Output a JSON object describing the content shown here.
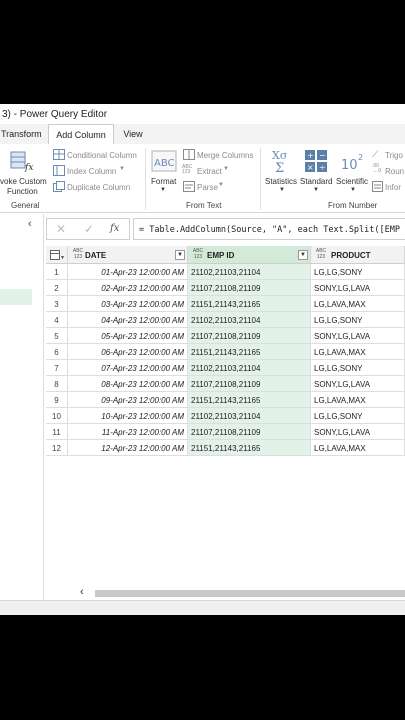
{
  "window": {
    "title": "3) - Power Query Editor"
  },
  "tabs": [
    {
      "label": "Transform",
      "active": false
    },
    {
      "label": "Add Column",
      "active": true
    },
    {
      "label": "View",
      "active": false
    }
  ],
  "ribbon": {
    "general": {
      "invoke_line1": "voke Custom",
      "invoke_line2": "Function",
      "conditional": "Conditional Column",
      "index": "Index Column",
      "duplicate": "Duplicate Column",
      "label": "General"
    },
    "from_text": {
      "format": "Format",
      "merge": "Merge Columns",
      "extract": "Extract",
      "parse": "Parse",
      "label": "From Text"
    },
    "from_number": {
      "statistics": "Statistics",
      "standard": "Standard",
      "scientific": "Scientific",
      "trig": "Trigo",
      "round": "Roun",
      "info": "Infor",
      "label": "From Number"
    }
  },
  "formula_bar": {
    "fx": "fx",
    "formula": "= Table.AddColumn(Source, \"A\", each Text.Split([EMP"
  },
  "table": {
    "type_labels": {
      "abc": "ABC",
      "num": "123"
    },
    "columns": [
      "DATE",
      "EMP ID",
      "PRODUCT"
    ],
    "rows": [
      {
        "n": "1",
        "date": "01-Apr-23 12:00:00 AM",
        "emp": "21102,21103,21104",
        "prod": "LG,LG,SONY"
      },
      {
        "n": "2",
        "date": "02-Apr-23 12:00:00 AM",
        "emp": "21107,21108,21109",
        "prod": "SONY,LG,LAVA"
      },
      {
        "n": "3",
        "date": "03-Apr-23 12:00:00 AM",
        "emp": "21151,21143,21165",
        "prod": "LG,LAVA,MAX"
      },
      {
        "n": "4",
        "date": "04-Apr-23 12:00:00 AM",
        "emp": "21102,21103,21104",
        "prod": "LG,LG,SONY"
      },
      {
        "n": "5",
        "date": "05-Apr-23 12:00:00 AM",
        "emp": "21107,21108,21109",
        "prod": "SONY,LG,LAVA"
      },
      {
        "n": "6",
        "date": "06-Apr-23 12:00:00 AM",
        "emp": "21151,21143,21165",
        "prod": "LG,LAVA,MAX"
      },
      {
        "n": "7",
        "date": "07-Apr-23 12:00:00 AM",
        "emp": "21102,21103,21104",
        "prod": "LG,LG,SONY"
      },
      {
        "n": "8",
        "date": "08-Apr-23 12:00:00 AM",
        "emp": "21107,21108,21109",
        "prod": "SONY,LG,LAVA"
      },
      {
        "n": "9",
        "date": "09-Apr-23 12:00:00 AM",
        "emp": "21151,21143,21165",
        "prod": "LG,LAVA,MAX"
      },
      {
        "n": "10",
        "date": "10-Apr-23 12:00:00 AM",
        "emp": "21102,21103,21104",
        "prod": "LG,LG,SONY"
      },
      {
        "n": "11",
        "date": "11-Apr-23 12:00:00 AM",
        "emp": "21107,21108,21109",
        "prod": "SONY,LG,LAVA"
      },
      {
        "n": "12",
        "date": "12-Apr-23 12:00:00 AM",
        "emp": "21151,21143,21165",
        "prod": "LG,LAVA,MAX"
      }
    ]
  },
  "colors": {
    "selected_column": "#e3f2e8",
    "query_selected": "#e3f2e8",
    "accent": "#217346"
  }
}
